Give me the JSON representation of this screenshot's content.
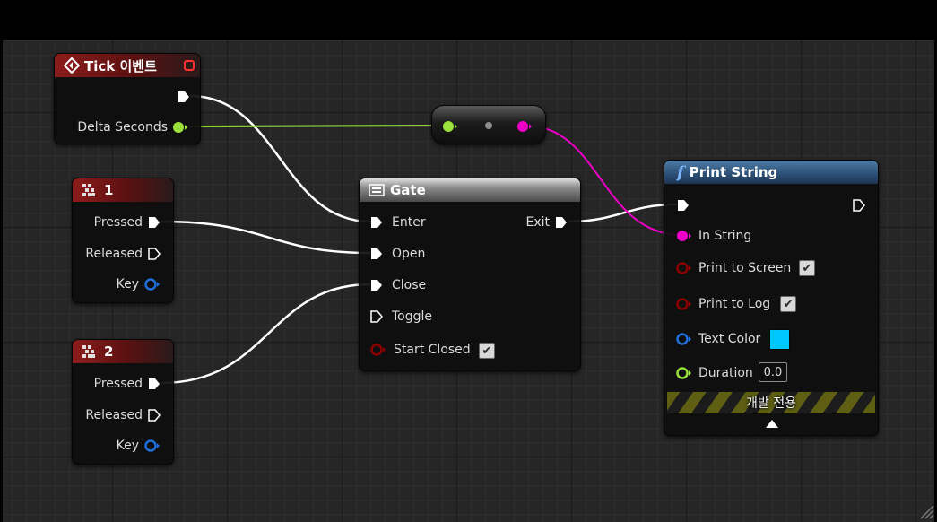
{
  "tick_node": {
    "title": "Tick 이벤트",
    "pins": {
      "delta": "Delta Seconds"
    }
  },
  "key1_node": {
    "title": "1",
    "pins": {
      "pressed": "Pressed",
      "released": "Released",
      "key": "Key"
    }
  },
  "key2_node": {
    "title": "2",
    "pins": {
      "pressed": "Pressed",
      "released": "Released",
      "key": "Key"
    }
  },
  "gate_node": {
    "title": "Gate",
    "pins": {
      "enter": "Enter",
      "open": "Open",
      "close": "Close",
      "toggle": "Toggle",
      "start_closed": "Start Closed",
      "exit": "Exit"
    },
    "start_closed_checked": true
  },
  "print_node": {
    "title": "Print String",
    "pins": {
      "in_string": "In String",
      "print_to_screen": "Print to Screen",
      "print_to_log": "Print to Log",
      "text_color": "Text Color",
      "duration": "Duration"
    },
    "print_to_screen_checked": true,
    "print_to_log_checked": true,
    "duration_value": "0.0",
    "dev_only_label": "개발 전용"
  },
  "colors": {
    "exec_wire": "#ffffff",
    "float_wire": "#9be23d",
    "string_wire": "#ee00c8",
    "text_color_swatch": "#00c8ff",
    "event_header": "#8d1b1b",
    "function_header": "#2b4e74"
  }
}
